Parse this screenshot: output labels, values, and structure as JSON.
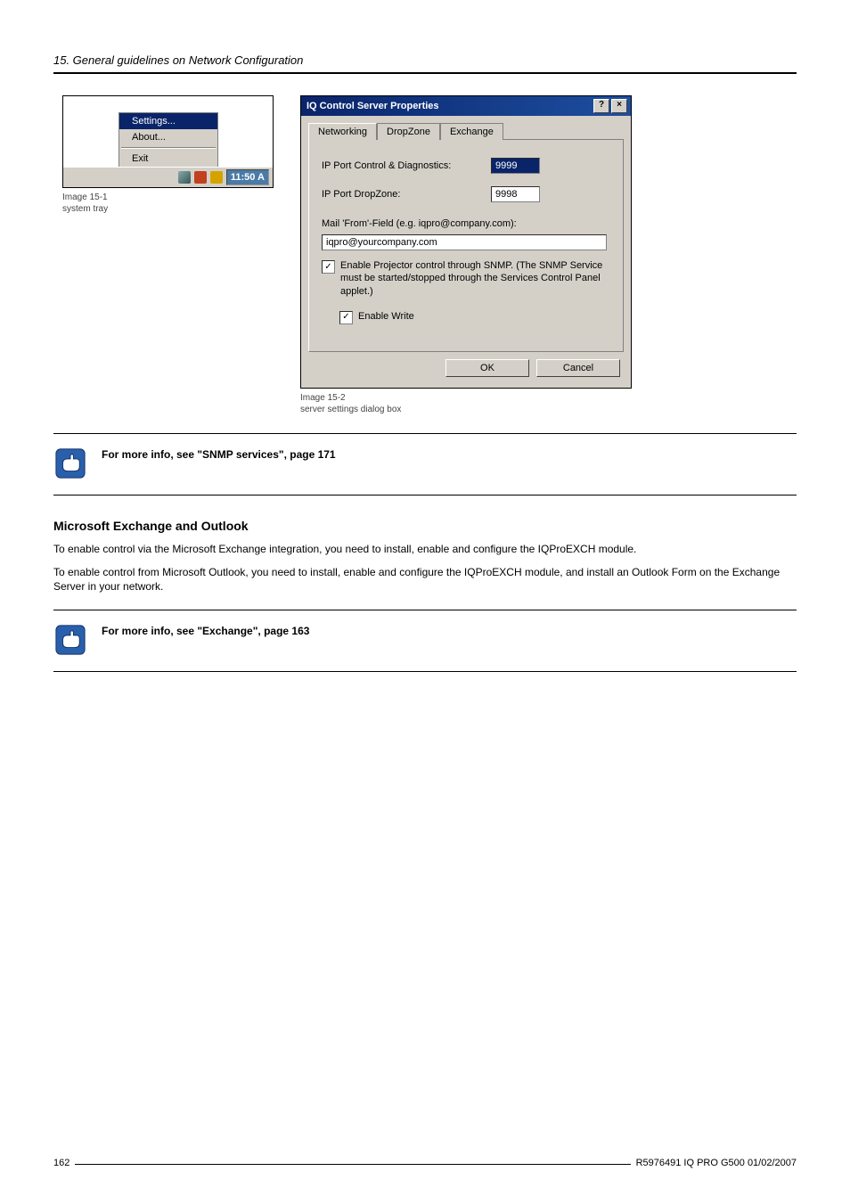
{
  "header": {
    "chapter": "15.  General guidelines on Network Configuration"
  },
  "fig1": {
    "menu": {
      "settings": "Settings...",
      "about": "About...",
      "exit": "Exit"
    },
    "time": "11:50 A",
    "caption_line1": "Image 15-1",
    "caption_line2": "system tray"
  },
  "fig2": {
    "title": "IQ Control Server Properties",
    "tabs": {
      "networking": "Networking",
      "dropzone": "DropZone",
      "exchange": "Exchange"
    },
    "lbl_port_ctrl": "IP Port Control & Diagnostics:",
    "val_port_ctrl": "9999",
    "lbl_port_dz": "IP Port DropZone:",
    "val_port_dz": "9998",
    "lbl_mailfrom": "Mail 'From'-Field (e.g. iqpro@company.com):",
    "val_mailfrom": "iqpro@yourcompany.com",
    "chk_snmp": "Enable Projector control through SNMP. (The SNMP Service must be started/stopped through the Services Control Panel applet.)",
    "chk_write": "Enable Write",
    "btn_ok": "OK",
    "btn_cancel": "Cancel",
    "help_btn": "?",
    "close_btn": "×",
    "caption_line1": "Image 15-2",
    "caption_line2": "server settings dialog box"
  },
  "note1": "For more info, see \"SNMP services\", page 171",
  "section_title": "Microsoft Exchange and Outlook",
  "para1": "To enable control via the Microsoft Exchange integration, you need to install, enable and configure the IQProEXCH module.",
  "para2": "To enable control from Microsoft Outlook, you need to install, enable and configure the IQProEXCH module, and install an Outlook Form on the Exchange Server in your network.",
  "note2": "For more info, see \"Exchange\", page 163",
  "footer": {
    "page": "162",
    "doc": "R5976491  IQ PRO G500  01/02/2007"
  }
}
